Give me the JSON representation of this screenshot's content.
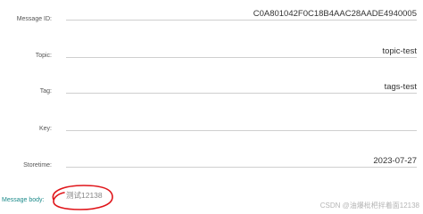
{
  "fields": [
    {
      "label": "Message ID:",
      "value": "C0A801042F0C18B4AAC28AADE4940005"
    },
    {
      "label": "Topic:",
      "value": "topic-test"
    },
    {
      "label": "Tag:",
      "value": "tags-test"
    },
    {
      "label": "Key:",
      "value": ""
    },
    {
      "label": "Storetime:",
      "value": "2023-07-27"
    }
  ],
  "message_body": {
    "label": "Message body:",
    "value": "测试12138"
  },
  "annotation": {
    "color": "#e0151a",
    "shape": "freehand-ellipse"
  },
  "watermark": "CSDN @油爆枇杷拌着面12138"
}
